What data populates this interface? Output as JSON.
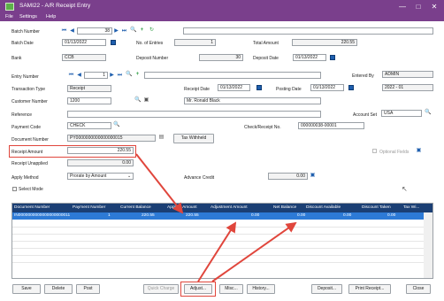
{
  "window": {
    "title": "SAMI22 - A/R Receipt Entry",
    "controls": [
      "—",
      "□",
      "✕"
    ]
  },
  "menu": [
    "File",
    "Settings",
    "Help"
  ],
  "batch": {
    "number_label": "Batch Number",
    "number": "38",
    "date_label": "Batch Date",
    "date": "01/13/2022",
    "entries_label": "No. of Entries",
    "entries": "1",
    "total_label": "Total Amount",
    "total": "220.55",
    "bank_label": "Bank",
    "bank": "CCB",
    "deposit_label": "Deposit Number",
    "deposit": "30",
    "deposit_date_label": "Deposit Date",
    "deposit_date": "01/13/2022"
  },
  "entry": {
    "number_label": "Entry Number",
    "number": "1",
    "entered_by_label": "Entered By",
    "entered_by": "ADMIN",
    "type_label": "Transaction Type",
    "type": "Receipt",
    "receipt_date_label": "Receipt Date",
    "receipt_date": "01/13/2022",
    "posting_date_label": "Posting Date",
    "posting_date": "01/13/2022",
    "year_period": "2022 - 01",
    "customer_label": "Customer Number",
    "customer": "1200",
    "customer_name": "Mr. Ronald Black",
    "reference_label": "Reference",
    "account_set_label": "Account Set",
    "account_set": "USA",
    "payment_code_label": "Payment Code",
    "payment_code": "CHECK",
    "check_label": "Check/Receipt No.",
    "check": "000000038-00001",
    "document_label": "Document Number",
    "document": "PY0000000000000000015",
    "tax_button": "Tax Withheld",
    "receipt_amount_label": "Receipt Amount",
    "receipt_amount": "220.55",
    "optional_fields_label": "Optional Fields",
    "unapplied_label": "Receipt Unapplied",
    "unapplied": "0.00",
    "apply_method_label": "Apply Method",
    "apply_method": "Prorate by Amount",
    "advance_credit_label": "Advance Credit",
    "advance_credit": "0.00",
    "select_mode_label": "Select Mode"
  },
  "grid": {
    "columns": [
      "Document Number",
      "Payment Number",
      "Current Balance",
      "Applied Amount",
      "Adjustment Amount",
      "Net Balance",
      "Discount Available",
      "Discount Taken",
      "Tax Wi..."
    ],
    "rows": [
      [
        "IN0000000000000000000011",
        "1",
        "220.55",
        "220.55",
        "0.00",
        "0.00",
        "0.00",
        "0.00",
        ""
      ]
    ]
  },
  "buttons": [
    "Save",
    "Delete",
    "Post",
    "Quick Charge",
    "Adjust...",
    "Misc...",
    "History...",
    "Deposit...",
    "Print Receipt...",
    "Close"
  ]
}
